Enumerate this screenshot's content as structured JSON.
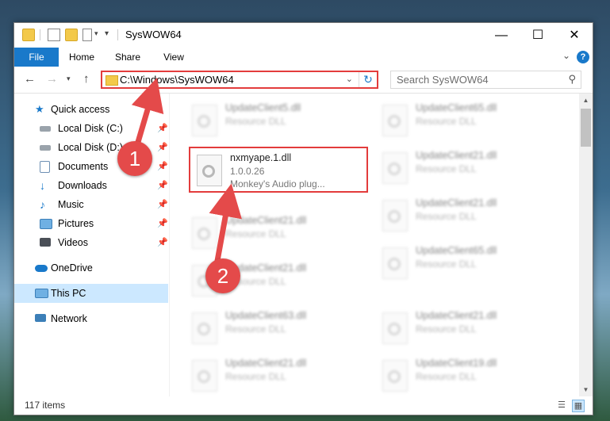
{
  "window": {
    "title": "SysWOW64",
    "controls": {
      "minimize": "—",
      "maximize": "☐",
      "close": "✕"
    }
  },
  "ribbon": {
    "tabs": [
      "File",
      "Home",
      "Share",
      "View"
    ],
    "help_label": "?"
  },
  "nav": {
    "address": "C:\\Windows\\SysWOW64",
    "search_placeholder": "Search SysWOW64"
  },
  "sidebar": {
    "items": [
      {
        "label": "Quick access",
        "icon": "star-icon",
        "pinned": false
      },
      {
        "label": "Local Disk (C:)",
        "icon": "drive-icon",
        "pinned": true
      },
      {
        "label": "Local Disk (D:)",
        "icon": "drive-icon",
        "pinned": true
      },
      {
        "label": "Documents",
        "icon": "documents-icon",
        "pinned": true
      },
      {
        "label": "Downloads",
        "icon": "download-icon",
        "pinned": true
      },
      {
        "label": "Music",
        "icon": "music-icon",
        "pinned": true
      },
      {
        "label": "Pictures",
        "icon": "pictures-icon",
        "pinned": true
      },
      {
        "label": "Videos",
        "icon": "videos-icon",
        "pinned": true
      },
      {
        "label": "OneDrive",
        "icon": "cloud-icon",
        "pinned": false
      },
      {
        "label": "This PC",
        "icon": "computer-icon",
        "pinned": false,
        "selected": true
      },
      {
        "label": "Network",
        "icon": "network-icon",
        "pinned": false
      }
    ]
  },
  "files": {
    "left": [
      {
        "name": "UpdateClient5.dll",
        "desc": "Resource DLL"
      },
      {
        "name": "nxmyape.1.dll",
        "version": "1.0.0.26",
        "desc": "Monkey's Audio plug...",
        "highlighted": true
      },
      {
        "name": "UpdateClient21.dll",
        "desc": "Resource DLL"
      },
      {
        "name": "UpdateClient21.dll",
        "desc": "Resource DLL"
      },
      {
        "name": "UpdateClient63.dll",
        "desc": "Resource DLL"
      },
      {
        "name": "UpdateClient21.dll",
        "desc": "Resource DLL"
      }
    ],
    "right": [
      {
        "name": "UpdateClient65.dll",
        "desc": "Resource DLL"
      },
      {
        "name": "UpdateClient21.dll",
        "desc": "Resource DLL"
      },
      {
        "name": "UpdateClient21.dll",
        "desc": "Resource DLL"
      },
      {
        "name": "UpdateClient65.dll",
        "desc": "Resource DLL"
      },
      {
        "name": "UpdateClient21.dll",
        "desc": "Resource DLL"
      },
      {
        "name": "UpdateClient19.dll",
        "desc": "Resource DLL"
      }
    ]
  },
  "status": {
    "item_count": "117 items"
  },
  "annotations": {
    "step1": "1",
    "step2": "2",
    "accent": "#e33c3c"
  }
}
